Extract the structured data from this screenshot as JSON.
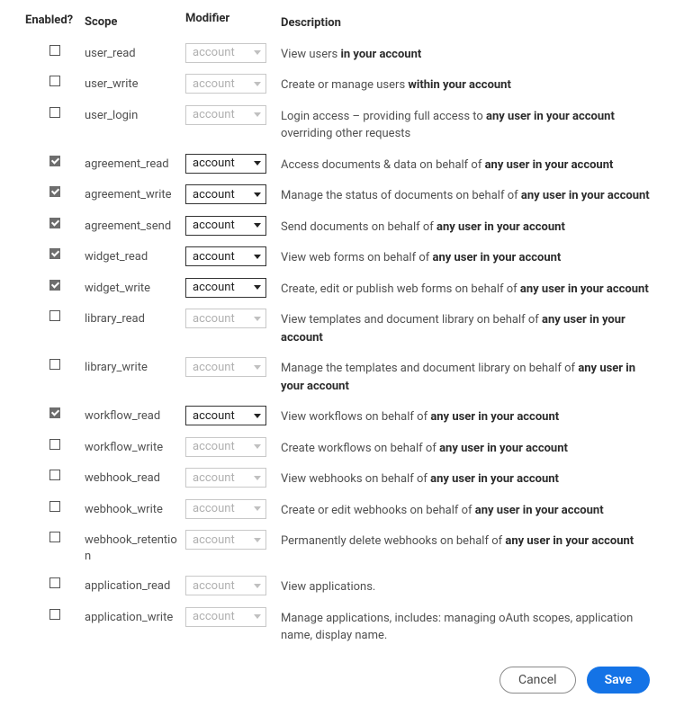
{
  "headers": {
    "enabled": "Enabled?",
    "scope": "Scope",
    "modifier": "Modifier",
    "description": "Description"
  },
  "modifier_value": "account",
  "rows": [
    {
      "enabled": false,
      "scope": "user_read",
      "desc_pre": "View users ",
      "desc_bold": "in your account",
      "desc_post": ""
    },
    {
      "enabled": false,
      "scope": "user_write",
      "desc_pre": "Create or manage users ",
      "desc_bold": "within your account",
      "desc_post": ""
    },
    {
      "enabled": false,
      "scope": "user_login",
      "desc_pre": "Login access – providing full access to ",
      "desc_bold": "any user in your account",
      "desc_post": " overriding other requests"
    },
    {
      "enabled": true,
      "scope": "agreement_read",
      "desc_pre": "Access documents & data on behalf of ",
      "desc_bold": "any user in your account",
      "desc_post": ""
    },
    {
      "enabled": true,
      "scope": "agreement_write",
      "desc_pre": "Manage the status of documents on behalf of ",
      "desc_bold": "any user in your account",
      "desc_post": ""
    },
    {
      "enabled": true,
      "scope": "agreement_send",
      "desc_pre": "Send documents on behalf of ",
      "desc_bold": "any user in your account",
      "desc_post": ""
    },
    {
      "enabled": true,
      "scope": "widget_read",
      "desc_pre": "View web forms on behalf of ",
      "desc_bold": "any user in your account",
      "desc_post": ""
    },
    {
      "enabled": true,
      "scope": "widget_write",
      "desc_pre": "Create, edit or publish web forms on behalf of ",
      "desc_bold": "any user in your account",
      "desc_post": ""
    },
    {
      "enabled": false,
      "scope": "library_read",
      "desc_pre": "View templates and document library on behalf of ",
      "desc_bold": "any user in your account",
      "desc_post": ""
    },
    {
      "enabled": false,
      "scope": "library_write",
      "desc_pre": "Manage the templates and document library on behalf of ",
      "desc_bold": "any user in your account",
      "desc_post": ""
    },
    {
      "enabled": true,
      "scope": "workflow_read",
      "desc_pre": "View workflows on behalf of ",
      "desc_bold": "any user in your account",
      "desc_post": ""
    },
    {
      "enabled": false,
      "scope": "workflow_write",
      "desc_pre": "Create workflows on behalf of ",
      "desc_bold": "any user in your account",
      "desc_post": ""
    },
    {
      "enabled": false,
      "scope": "webhook_read",
      "desc_pre": "View webhooks on behalf of ",
      "desc_bold": "any user in your account",
      "desc_post": ""
    },
    {
      "enabled": false,
      "scope": "webhook_write",
      "desc_pre": "Create or edit webhooks on behalf of ",
      "desc_bold": "any user in your account",
      "desc_post": ""
    },
    {
      "enabled": false,
      "scope": "webhook_retention",
      "desc_pre": "Permanently delete webhooks on behalf of ",
      "desc_bold": "any user in your account",
      "desc_post": ""
    },
    {
      "enabled": false,
      "scope": "application_read",
      "desc_pre": "View applications.",
      "desc_bold": "",
      "desc_post": ""
    },
    {
      "enabled": false,
      "scope": "application_write",
      "desc_pre": "Manage applications, includes: managing oAuth scopes, application name, display name.",
      "desc_bold": "",
      "desc_post": ""
    }
  ],
  "footer": {
    "cancel": "Cancel",
    "save": "Save"
  }
}
